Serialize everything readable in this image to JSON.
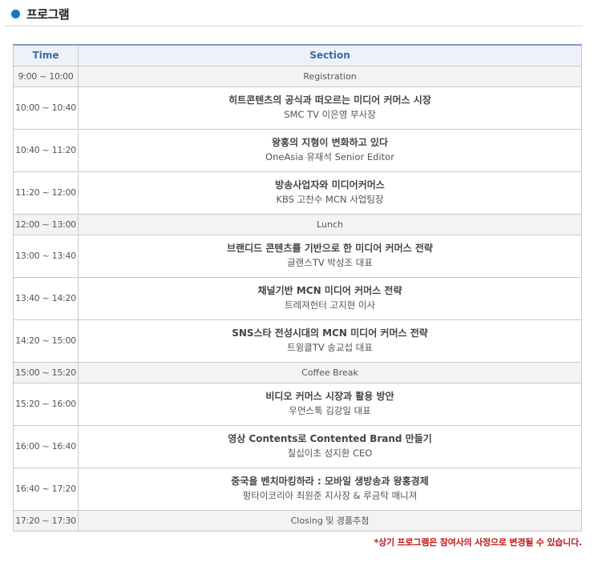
{
  "header": {
    "title": "프로그램"
  },
  "table": {
    "time_header": "Time",
    "section_header": "Section",
    "rows": [
      {
        "kind": "break",
        "time": "9:00 ~ 10:00",
        "label": "Registration"
      },
      {
        "kind": "talk",
        "time": "10:00 ~ 10:40",
        "title": "히트콘텐츠의 공식과 떠오르는 미디어 커머스 시장",
        "speaker": "SMC TV 이은영 부사장"
      },
      {
        "kind": "talk",
        "time": "10:40 ~ 11:20",
        "title": "왕홍의 지형이 변화하고 있다",
        "speaker": "OneAsia 유재석 Senior Editor"
      },
      {
        "kind": "talk",
        "time": "11:20 ~ 12:00",
        "title": "방송사업자와 미디어커머스",
        "speaker": "KBS 고찬수 MCN 사업팀장"
      },
      {
        "kind": "break",
        "time": "12:00 ~ 13:00",
        "label": "Lunch"
      },
      {
        "kind": "talk",
        "time": "13:00 ~ 13:40",
        "title": "브랜디드 콘텐츠를 기반으로 한 미디어 커머스 전략",
        "speaker": "글랜스TV 박성조 대표"
      },
      {
        "kind": "talk",
        "time": "13:40 ~ 14:20",
        "title": "채널기반 MCN 미디어 커머스 전략",
        "speaker": "트레져헌터 고지현 이사"
      },
      {
        "kind": "talk",
        "time": "14:20 ~ 15:00",
        "title": "SNS스타 전성시대의 MCN 미디어 커머스 전략",
        "speaker": "트윙클TV 송교섭 대표"
      },
      {
        "kind": "break",
        "time": "15:00 ~ 15:20",
        "label": "Coffee Break"
      },
      {
        "kind": "talk",
        "time": "15:20 ~ 16:00",
        "title": "비디오 커머스 시장과 활용 방안",
        "speaker": "우먼스톡 김강일 대표"
      },
      {
        "kind": "talk",
        "time": "16:00 ~ 16:40",
        "title": "영상 Contents로 Contented Brand 만들기",
        "speaker": "칠십이초 성지환 CEO"
      },
      {
        "kind": "talk",
        "time": "16:40 ~ 17:20",
        "title": "중국을 벤치마킹하라 : 모바일 생방송과 왕홍경제",
        "speaker": "펑타이코리아 최원준 지사장 & 루금탁 매니져"
      },
      {
        "kind": "break",
        "time": "17:20 ~ 17:30",
        "label": "Closing 및 경품추첨"
      }
    ]
  },
  "footer_note": "*상기 프로그램은 참여사의 사정으로 변경될 수 있습니다.",
  "colors": {
    "bullet": "#1a73c9",
    "header_text": "#3b6ba8",
    "note": "#c0181c"
  }
}
